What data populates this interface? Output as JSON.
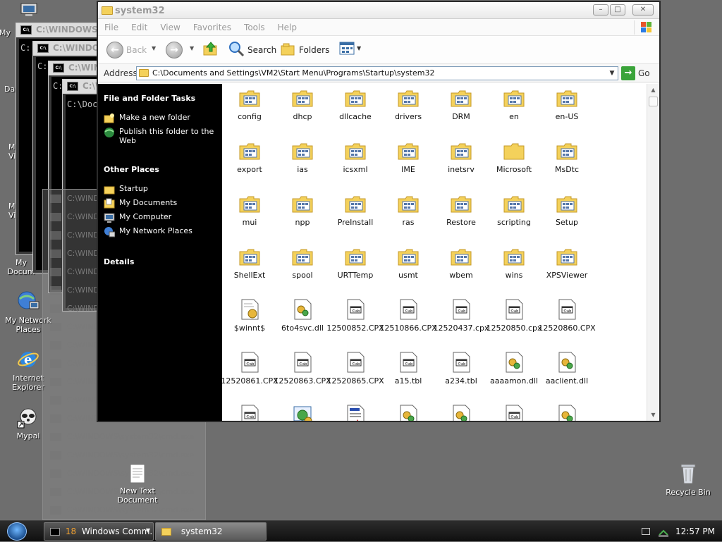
{
  "desktop": {
    "icons": {
      "my_computer": "My",
      "data": "Da",
      "my_v1": "My\nVi",
      "my_v2": "My\nVi",
      "my_documents": "My\nDocum",
      "my_network_places": "My Network\nPlaces",
      "internet_explorer": "Internet\nExplorer",
      "mypal": "Mypal",
      "new_text_document": "New Text\nDocument",
      "recycle_bin": "Recycle Bin"
    }
  },
  "cmd_windows": {
    "title_1": "C:\\WINDOWS\\s",
    "title_2": "C:\\WINDO",
    "title_3": "C:\\WIN",
    "title_4": "C:\\WI",
    "prompt": "C:\\Doc",
    "prompt_short": "C:",
    "item_text": "C:\\WINDOWS\\system32\\cmd.exe"
  },
  "explorer": {
    "title": "system32",
    "menu": [
      "File",
      "Edit",
      "View",
      "Favorites",
      "Tools",
      "Help"
    ],
    "toolbar": {
      "back": "Back",
      "search": "Search",
      "folders": "Folders"
    },
    "address": {
      "label": "Address",
      "value": "C:\\Documents and Settings\\VM2\\Start Menu\\Programs\\Startup\\system32",
      "go": "Go"
    },
    "taskpane": {
      "file_folder_tasks": "File and Folder Tasks",
      "make_folder": "Make a new folder",
      "publish": "Publish this folder to the Web",
      "other_places": "Other Places",
      "places": [
        "Startup",
        "My Documents",
        "My Computer",
        "My Network Places"
      ],
      "details": "Details"
    },
    "items": [
      {
        "label": "config",
        "kind": "folder-special"
      },
      {
        "label": "dhcp",
        "kind": "folder-special"
      },
      {
        "label": "dllcache",
        "kind": "folder-special"
      },
      {
        "label": "drivers",
        "kind": "folder-special"
      },
      {
        "label": "DRM",
        "kind": "folder-special"
      },
      {
        "label": "en",
        "kind": "folder-special"
      },
      {
        "label": "en-US",
        "kind": "folder-special"
      },
      {
        "label": "export",
        "kind": "folder-special"
      },
      {
        "label": "ias",
        "kind": "folder-special"
      },
      {
        "label": "icsxml",
        "kind": "folder-special"
      },
      {
        "label": "IME",
        "kind": "folder-special"
      },
      {
        "label": "inetsrv",
        "kind": "folder-special"
      },
      {
        "label": "Microsoft",
        "kind": "folder"
      },
      {
        "label": "MsDtc",
        "kind": "folder-special"
      },
      {
        "label": "mui",
        "kind": "folder-special"
      },
      {
        "label": "npp",
        "kind": "folder-special"
      },
      {
        "label": "PreInstall",
        "kind": "folder-special"
      },
      {
        "label": "ras",
        "kind": "folder-special"
      },
      {
        "label": "Restore",
        "kind": "folder-special"
      },
      {
        "label": "scripting",
        "kind": "folder-special"
      },
      {
        "label": "Setup",
        "kind": "folder-special"
      },
      {
        "label": "ShellExt",
        "kind": "folder-special"
      },
      {
        "label": "spool",
        "kind": "folder-special"
      },
      {
        "label": "URTTemp",
        "kind": "folder-special"
      },
      {
        "label": "usmt",
        "kind": "folder-special"
      },
      {
        "label": "wbem",
        "kind": "folder-special"
      },
      {
        "label": "wins",
        "kind": "folder-special"
      },
      {
        "label": "XPSViewer",
        "kind": "folder-special"
      },
      {
        "label": "$winnt$",
        "kind": "file-gear"
      },
      {
        "label": "6to4svc.dll",
        "kind": "dll"
      },
      {
        "label": "12500852.CPX",
        "kind": "cpx"
      },
      {
        "label": "12510866.CPX",
        "kind": "cpx"
      },
      {
        "label": "12520437.cpx",
        "kind": "cpx"
      },
      {
        "label": "12520850.cpx",
        "kind": "cpx"
      },
      {
        "label": "12520860.CPX",
        "kind": "cpx"
      },
      {
        "label": "12520861.CPX",
        "kind": "cpx"
      },
      {
        "label": "12520863.CPX",
        "kind": "cpx"
      },
      {
        "label": "12520865.CPX",
        "kind": "cpx"
      },
      {
        "label": "a15.tbl",
        "kind": "cpx"
      },
      {
        "label": "a234.tbl",
        "kind": "cpx"
      },
      {
        "label": "aaaamon.dll",
        "kind": "dll"
      },
      {
        "label": "aaclient.dll",
        "kind": "dll"
      },
      {
        "label": "",
        "kind": "cpx"
      },
      {
        "label": "",
        "kind": "exe-gear"
      },
      {
        "label": "",
        "kind": "doc"
      },
      {
        "label": "",
        "kind": "dll"
      },
      {
        "label": "",
        "kind": "dll"
      },
      {
        "label": "",
        "kind": "cpx"
      },
      {
        "label": "",
        "kind": "dll"
      }
    ]
  },
  "taskbar": {
    "cmd_button": "Windows Comm...",
    "explorer_button": "system32",
    "clock": "12:57 PM"
  },
  "colors": {
    "desktop": "#6e6e6e",
    "taskpane": "#000000",
    "folder_yellow": "#f4d15b",
    "go_green": "#3aa43a"
  }
}
